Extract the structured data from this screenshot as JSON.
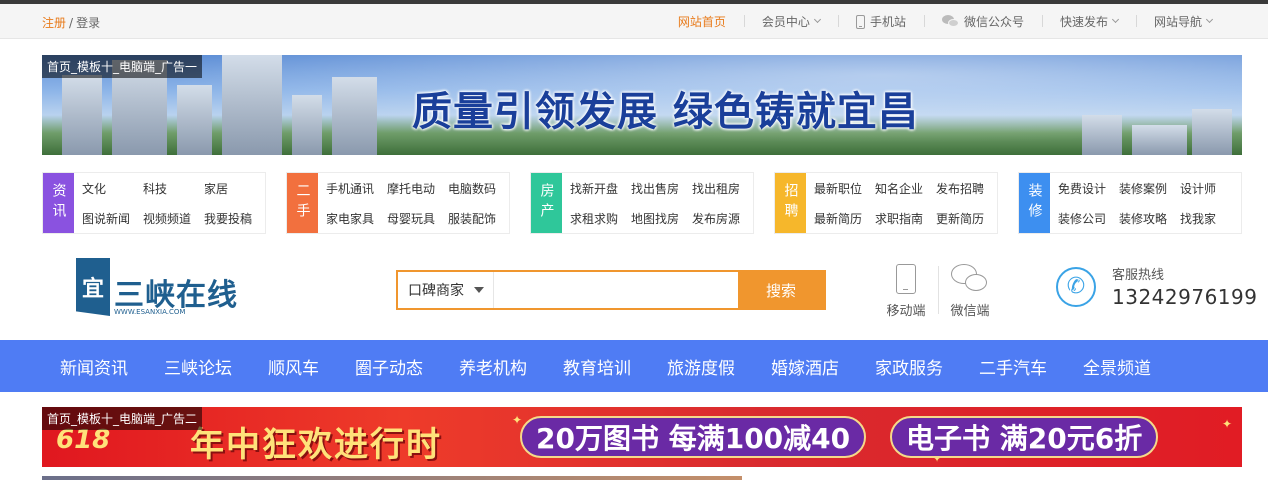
{
  "topbar": {
    "register": "注册",
    "separator": "/",
    "login": "登录",
    "items": [
      {
        "label": "网站首页",
        "active": true
      },
      {
        "label": "会员中心",
        "caret": true
      },
      {
        "label": "手机站",
        "icon": "phone-icon"
      },
      {
        "label": "微信公众号",
        "icon": "wechat-icon"
      },
      {
        "label": "快速发布",
        "caret": true
      },
      {
        "label": "网站导航",
        "caret": true
      }
    ]
  },
  "ad_top": {
    "label": "首页_模板十_电脑端_广告一",
    "headline": "质量引领发展  绿色铸就宜昌"
  },
  "categories": [
    {
      "tag": "资讯",
      "color": "#8a52e0",
      "links": [
        "文化",
        "科技",
        "家居",
        "图说新闻",
        "视频频道",
        "我要投稿"
      ]
    },
    {
      "tag": "二手",
      "color": "#f2703e",
      "links": [
        "手机通讯",
        "摩托电动",
        "电脑数码",
        "家电家具",
        "母婴玩具",
        "服装配饰"
      ]
    },
    {
      "tag": "房产",
      "color": "#2fc79a",
      "links": [
        "找新开盘",
        "找出售房",
        "找出租房",
        "求租求购",
        "地图找房",
        "发布房源"
      ]
    },
    {
      "tag": "招聘",
      "color": "#f6b72b",
      "links": [
        "最新职位",
        "知名企业",
        "发布招聘",
        "最新简历",
        "求职指南",
        "更新简历"
      ]
    },
    {
      "tag": "装修",
      "color": "#3d8ff0",
      "links": [
        "免费设计",
        "装修案例",
        "设计师",
        "装修公司",
        "装修攻略",
        "找我家"
      ]
    }
  ],
  "logo": {
    "mark": "宜",
    "name": "三峡在线",
    "sub": "WWW.ESANXIA.COM"
  },
  "search": {
    "type_selected": "口碑商家",
    "value": "",
    "button": "搜索"
  },
  "apps": [
    {
      "label": "移动端",
      "icon": "mobile-icon"
    },
    {
      "label": "微信端",
      "icon": "wechat-icon"
    }
  ],
  "hotline": {
    "label": "客服热线",
    "number": "13242976199"
  },
  "nav": [
    "新闻资讯",
    "三峡论坛",
    "顺风车",
    "圈子动态",
    "养老机构",
    "教育培训",
    "旅游度假",
    "婚嫁酒店",
    "家政服务",
    "二手汽车",
    "全景频道"
  ],
  "ad_bottom": {
    "label": "首页_模板十_电脑端_广告二",
    "badge": "618",
    "headline": "年中狂欢进行时",
    "promo1": "20万图书 每满100减40",
    "promo2": "电子书 满20元6折"
  }
}
